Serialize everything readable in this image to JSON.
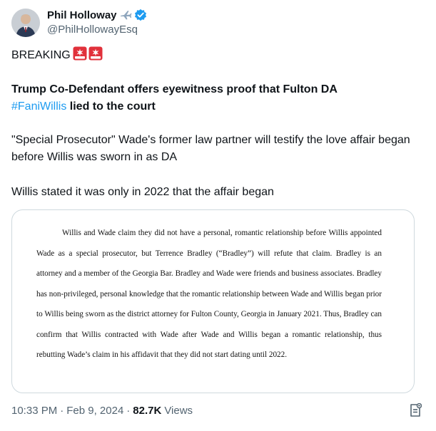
{
  "author": {
    "name": "Phil Holloway",
    "handle": "@PhilHollowayEsq",
    "name_emoji": "airplane-icon",
    "verified": true,
    "verified_color": "#1d9bf0"
  },
  "tweet": {
    "line1": "BREAKING",
    "line1_emojis": [
      "rotating-light-icon",
      "rotating-light-icon"
    ],
    "headline_part1": "Trump Co-Defendant offers eyewitness proof that Fulton DA",
    "hashtag": "#FaniWillis",
    "headline_part2": " lied to the court",
    "paragraph2": "\"Special Prosecutor\" Wade's former law partner will testify the love affair began before Willis was sworn in as DA",
    "paragraph3": "Willis stated it was only in 2022 that the affair began"
  },
  "media": {
    "document_text": "Willis and Wade claim they did not have a personal, romantic relationship before Willis appointed Wade as a special prosecutor, but Terrence Bradley (“Bradley”) will refute that claim. Bradley is an attorney and a member of the Georgia Bar. Bradley and Wade were friends and business associates. Bradley has non-privileged, personal knowledge that the romantic relationship between Wade and Willis began prior to Willis being sworn as the district attorney for Fulton County, Georgia in January 2021. Thus, Bradley can confirm that Willis contracted with Wade after Wade and Willis began a romantic relationship, thus rebutting Wade’s claim in his affidavit that they did not start dating until 2022."
  },
  "meta": {
    "time": "10:33 PM",
    "separator": "·",
    "date": "Feb 9, 2024",
    "views_count": "82.7K",
    "views_label": "Views"
  },
  "colors": {
    "text": "#0f1419",
    "secondary": "#536471",
    "link": "#1d9bf0",
    "border": "#cfd9de"
  }
}
